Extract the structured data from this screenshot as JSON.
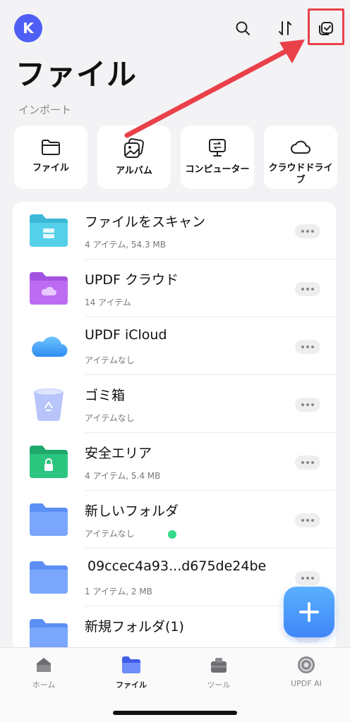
{
  "header": {
    "avatar_letter": "K",
    "title": "ファイル"
  },
  "import_section": {
    "label": "インポート",
    "items": [
      {
        "label": "ファイル",
        "icon": "folder-icon"
      },
      {
        "label": "アルバム",
        "icon": "album-icon"
      },
      {
        "label": "コンピューター",
        "icon": "computer-transfer-icon"
      },
      {
        "label": "クラウドドライブ",
        "icon": "cloud-icon"
      }
    ]
  },
  "files": [
    {
      "name": "ファイルをスキャン",
      "meta": "4 アイテム, 54.3 MB",
      "icon": "scan-folder-icon"
    },
    {
      "name": "UPDF クラウド",
      "meta": "14 アイテム",
      "icon": "updf-cloud-folder-icon"
    },
    {
      "name": "UPDF iCloud",
      "meta": "アイテムなし",
      "icon": "icloud-icon"
    },
    {
      "name": "ゴミ箱",
      "meta": "アイテムなし",
      "icon": "trash-icon"
    },
    {
      "name": "安全エリア",
      "meta": "4 アイテム, 5.4 MB",
      "icon": "secure-folder-icon"
    },
    {
      "name": "新しいフォルダ",
      "meta": "アイテムなし",
      "icon": "folder-icon"
    },
    {
      "name": "09ccec4a93...d675de24be",
      "meta": "1 アイテム, 2 MB",
      "icon": "folder-icon"
    },
    {
      "name": "新規フォルダ(1)",
      "meta": "",
      "icon": "folder-icon"
    }
  ],
  "bottom_nav": [
    {
      "label": "ホーム",
      "icon": "home-icon"
    },
    {
      "label": "ファイル",
      "icon": "files-icon",
      "active": true
    },
    {
      "label": "ツール",
      "icon": "tools-icon"
    },
    {
      "label": "UPDF AI",
      "icon": "ai-icon"
    }
  ],
  "colors": {
    "accent": "#4f5ff5",
    "highlight": "#e9404a",
    "fab": "#3f86f7"
  }
}
